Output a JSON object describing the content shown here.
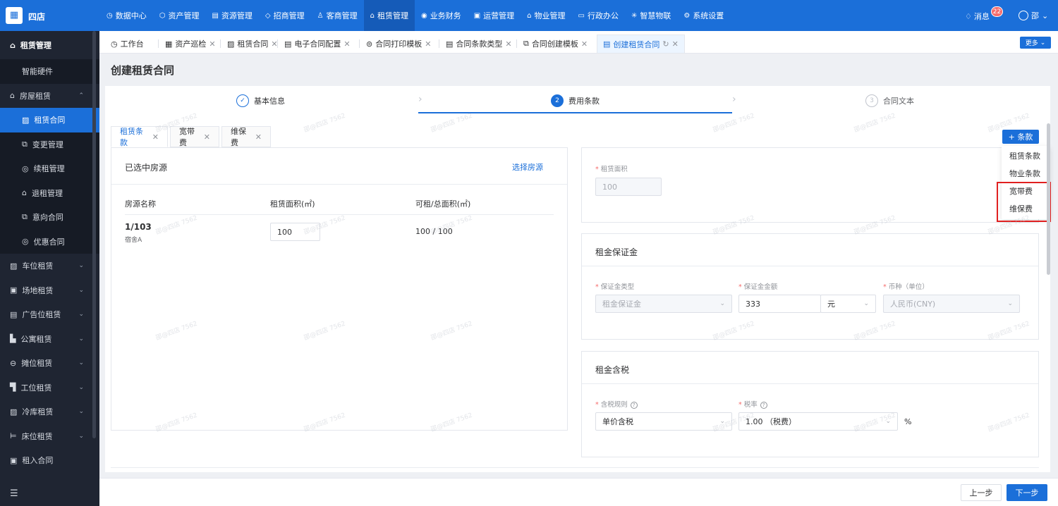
{
  "brand": {
    "logo_icon": "building-icon",
    "name": "四店"
  },
  "nav": [
    {
      "label": "数据中心",
      "icon": "◷"
    },
    {
      "label": "资产管理",
      "icon": "⬡"
    },
    {
      "label": "资源管理",
      "icon": "▤"
    },
    {
      "label": "招商管理",
      "icon": "◇"
    },
    {
      "label": "客商管理",
      "icon": "♙"
    },
    {
      "label": "租赁管理",
      "icon": "⌂"
    },
    {
      "label": "业务财务",
      "icon": "◉"
    },
    {
      "label": "运营管理",
      "icon": "▣"
    },
    {
      "label": "物业管理",
      "icon": "⌂"
    },
    {
      "label": "行政办公",
      "icon": "▭"
    },
    {
      "label": "智慧物联",
      "icon": "✳"
    },
    {
      "label": "系统设置",
      "icon": "⚙"
    }
  ],
  "header": {
    "messages_label": "消息",
    "messages_count": "22",
    "user_name": "邵"
  },
  "sidebar": {
    "title": "租赁管理",
    "items": [
      {
        "label": "智能硬件",
        "icon": ""
      },
      {
        "label": "房屋租赁",
        "icon": "⌂",
        "arrow": "⌃"
      },
      {
        "label": "租赁合同",
        "icon": "▨"
      },
      {
        "label": "变更管理",
        "icon": "⧉"
      },
      {
        "label": "续租管理",
        "icon": "◎"
      },
      {
        "label": "退租管理",
        "icon": "⌂"
      },
      {
        "label": "意向合同",
        "icon": "⧉"
      },
      {
        "label": "优惠合同",
        "icon": "◎"
      },
      {
        "label": "车位租赁",
        "icon": "▨",
        "arrow": "⌄"
      },
      {
        "label": "场地租赁",
        "icon": "▣",
        "arrow": "⌄"
      },
      {
        "label": "广告位租赁",
        "icon": "▤",
        "arrow": "⌄"
      },
      {
        "label": "公寓租赁",
        "icon": "▙",
        "arrow": "⌄"
      },
      {
        "label": "摊位租赁",
        "icon": "⊖",
        "arrow": "⌄"
      },
      {
        "label": "工位租赁",
        "icon": "▜",
        "arrow": "⌄"
      },
      {
        "label": "冷库租赁",
        "icon": "▨",
        "arrow": "⌄"
      },
      {
        "label": "床位租赁",
        "icon": "⊨",
        "arrow": "⌄"
      },
      {
        "label": "租入合同",
        "icon": "▣"
      }
    ],
    "footer_icon": "☰"
  },
  "tabs": [
    {
      "label": "工作台",
      "icon": "◷"
    },
    {
      "label": "资产巡检",
      "icon": "▦"
    },
    {
      "label": "租赁合同",
      "icon": "▨"
    },
    {
      "label": "电子合同配置",
      "icon": "▤"
    },
    {
      "label": "合同打印模板",
      "icon": "⊜"
    },
    {
      "label": "合同条款类型",
      "icon": "▤"
    },
    {
      "label": "合同创建模板",
      "icon": "⧉"
    },
    {
      "label": "创建租赁合同",
      "icon": "▤"
    }
  ],
  "more_label": "更多",
  "page_title": "创建租赁合同",
  "steps": [
    {
      "num": "✓",
      "label": "基本信息"
    },
    {
      "num": "2",
      "label": "费用条款"
    },
    {
      "num": "3",
      "label": "合同文本"
    }
  ],
  "clause_tabs": [
    "租赁条款",
    "宽带费",
    "维保费"
  ],
  "add_clause_label": "+ 条款",
  "clause_menu": [
    "租赁条款",
    "物业条款",
    "宽带费",
    "维保费"
  ],
  "room": {
    "title": "已选中房源",
    "select_link": "选择房源",
    "headers": [
      "房源名称",
      "租赁面积(㎡)",
      "可租/总面积(㎡)"
    ],
    "row": {
      "name": "1/103",
      "building": "宿舍A",
      "area": "100",
      "ratio": "100 / 100"
    }
  },
  "area": {
    "label": "租赁面积",
    "value": "100"
  },
  "deposit": {
    "title": "租金保证金",
    "type_label": "保证金类型",
    "type_value": "租金保证金",
    "amount_label": "保证金金额",
    "amount_value": "333",
    "unit": "元",
    "currency_label": "币种（单位）",
    "currency_value": "人民币(CNY)"
  },
  "tax": {
    "title": "租金含税",
    "rule_label": "含税规则",
    "rule_value": "单价含税",
    "rate_label": "税率",
    "rate_value": "1.00 （税费）",
    "percent": "%"
  },
  "watermark": "邵@四店 7562",
  "footer": {
    "prev": "上一步",
    "next": "下一步"
  }
}
